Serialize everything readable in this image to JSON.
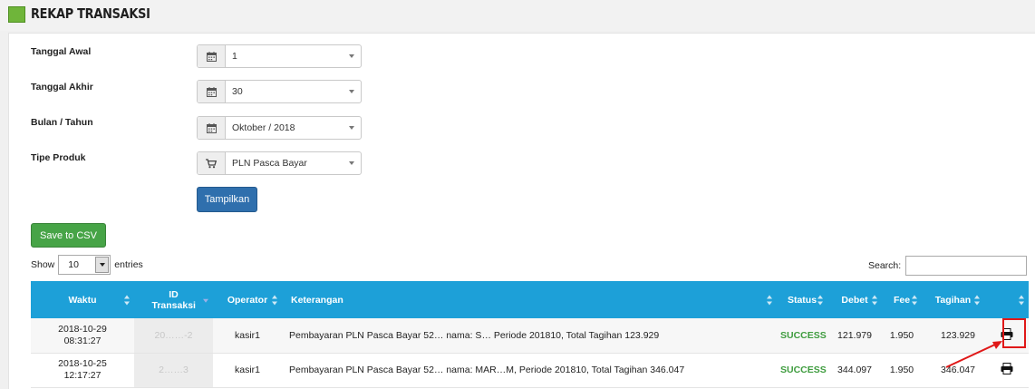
{
  "header": {
    "title": "REKAP TRANSAKSI",
    "accent_color": "#6fb53a"
  },
  "form": {
    "tanggal_awal": {
      "label": "Tanggal Awal",
      "value": "1",
      "icon": "calendar-icon"
    },
    "tanggal_akhir": {
      "label": "Tanggal Akhir",
      "value": "30",
      "icon": "calendar-icon"
    },
    "bulan_tahun": {
      "label": "Bulan / Tahun",
      "value": "Oktober / 2018",
      "icon": "calendar-icon"
    },
    "tipe_produk": {
      "label": "Tipe Produk",
      "value": "PLN Pasca Bayar",
      "icon": "cart-icon"
    },
    "submit_label": "Tampilkan"
  },
  "actions": {
    "csv_label": "Save to CSV"
  },
  "table_controls": {
    "show_label": "Show",
    "page_length": "10",
    "entries_label": "entries",
    "search_label": "Search:"
  },
  "table": {
    "columns": [
      "Waktu",
      "ID Transaksi",
      "Operator",
      "Keterangan",
      "Status",
      "Debet",
      "Fee",
      "Tagihan"
    ],
    "rows": [
      {
        "waktu_date": "2018-10-29",
        "waktu_time": "08:31:27",
        "id": "20……-2",
        "operator": "kasir1",
        "keterangan": "Pembayaran PLN Pasca Bayar 52… nama: S… Periode 201810, Total Tagihan 123.929",
        "status": "SUCCESS",
        "debet": "121.979",
        "fee": "1.950",
        "tagihan": "123.929"
      },
      {
        "waktu_date": "2018-10-25",
        "waktu_time": "12:17:27",
        "id": "2……3",
        "operator": "kasir1",
        "keterangan": "Pembayaran PLN Pasca Bayar 52… nama: MAR…M, Periode 201810, Total Tagihan 346.047",
        "status": "SUCCESS",
        "debet": "344.097",
        "fee": "1.950",
        "tagihan": "346.047"
      }
    ]
  },
  "colors": {
    "table_header": "#1da0d8",
    "status_success": "#3e9c3e",
    "primary_button": "#2f6fad",
    "success_button": "#47a447",
    "annotation": "#e01818"
  }
}
